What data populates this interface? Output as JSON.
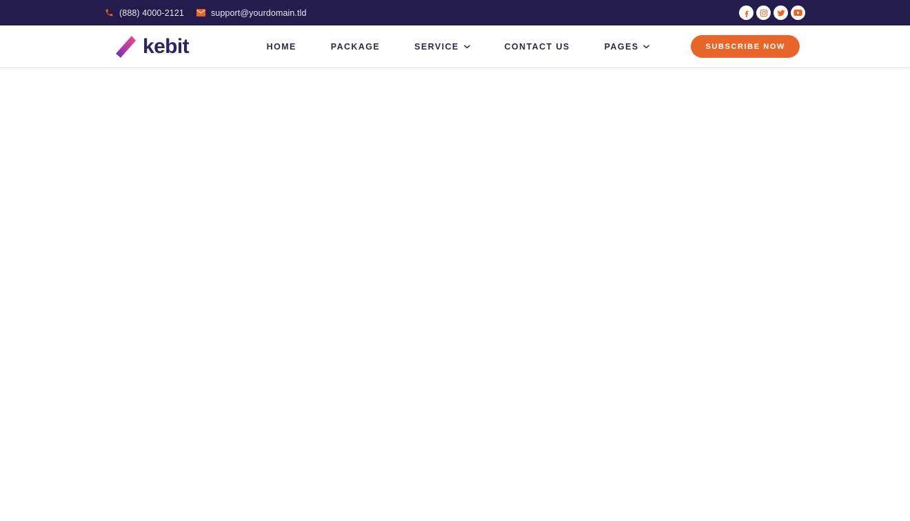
{
  "colors": {
    "topbar_bg": "#231c4c",
    "accent_orange": "#e8662a",
    "logo_navy": "#2b2461",
    "nav_text": "#2d2a45",
    "header_bg": "#ffffff",
    "body_bg": "#ffffff",
    "header_border": "#e6e6ea",
    "logo_gradient_from": "#e94d8f",
    "logo_gradient_to": "#6b30b0"
  },
  "topbar": {
    "phone": {
      "icon": "phone-icon",
      "text": "(888) 4000-2121"
    },
    "email": {
      "icon": "envelope-icon",
      "text": "support@yourdomain.tld"
    },
    "social": [
      {
        "icon": "facebook-icon",
        "label": "Facebook"
      },
      {
        "icon": "instagram-icon",
        "label": "Instagram"
      },
      {
        "icon": "twitter-icon",
        "label": "Twitter"
      },
      {
        "icon": "youtube-icon",
        "label": "YouTube"
      }
    ]
  },
  "header": {
    "logo": {
      "icon": "kebit-logo-mark",
      "text": "kebit"
    },
    "nav": [
      {
        "label": "HOME",
        "has_dropdown": false
      },
      {
        "label": "PACKAGE",
        "has_dropdown": false
      },
      {
        "label": "SERVICE",
        "has_dropdown": true
      },
      {
        "label": "CONTACT US",
        "has_dropdown": false
      },
      {
        "label": "PAGES",
        "has_dropdown": true
      }
    ],
    "cta": {
      "label": "SUBSCRIBE NOW"
    }
  },
  "main": {
    "content": ""
  }
}
